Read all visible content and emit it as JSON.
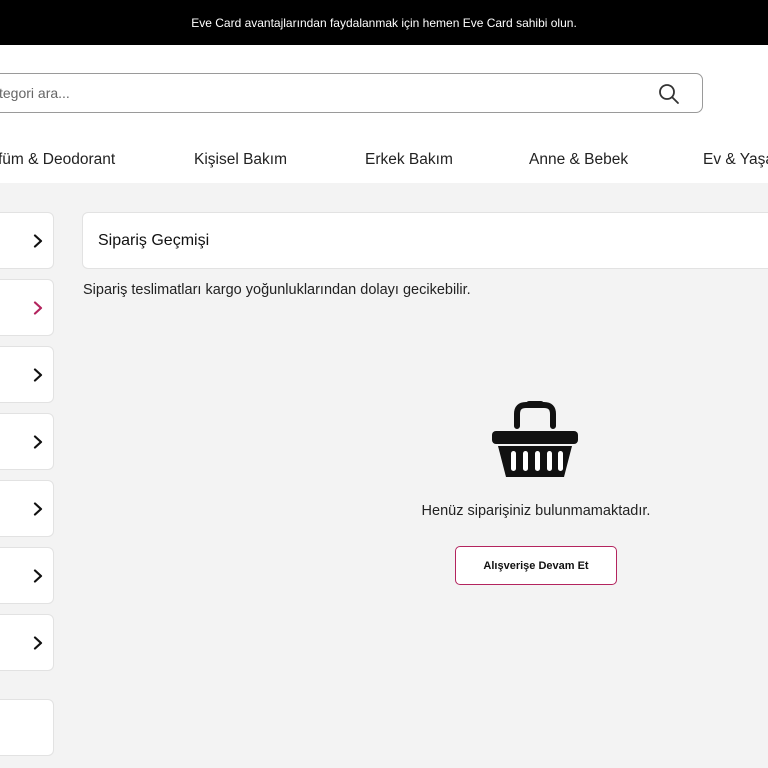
{
  "announcement": {
    "text": "Eve Card avantajlarından faydalanmak için hemen Eve Card sahibi olun."
  },
  "search": {
    "placeholder": "tegori ara...",
    "icon": "search-icon"
  },
  "nav": {
    "items": [
      {
        "label": "füm & Deodorant"
      },
      {
        "label": "Kişisel Bakım"
      },
      {
        "label": "Erkek Bakım"
      },
      {
        "label": "Anne & Bebek"
      },
      {
        "label": "Ev & Yaşa"
      }
    ]
  },
  "sidebar": {
    "items": [
      {
        "icon": "chevron-right-icon",
        "color": "#111111"
      },
      {
        "icon": "chevron-right-icon",
        "color": "#b3245e"
      },
      {
        "icon": "chevron-right-icon",
        "color": "#111111"
      },
      {
        "icon": "chevron-right-icon",
        "color": "#111111"
      },
      {
        "icon": "chevron-right-icon",
        "color": "#111111"
      },
      {
        "icon": "chevron-right-icon",
        "color": "#111111"
      },
      {
        "icon": "chevron-right-icon",
        "color": "#111111"
      },
      {
        "icon": "none",
        "color": "#111111"
      }
    ]
  },
  "main": {
    "title": "Sipariş Geçmişi",
    "notice": "Sipariş teslimatları kargo yoğunluklarından dolayı gecikebilir.",
    "empty_icon": "basket-icon",
    "empty_message": "Henüz siparişiniz bulunmamaktadır.",
    "continue_label": "Alışverişe Devam Et"
  },
  "colors": {
    "accent": "#b3245e",
    "topbar": "#000000",
    "background": "#f3f3f3"
  }
}
